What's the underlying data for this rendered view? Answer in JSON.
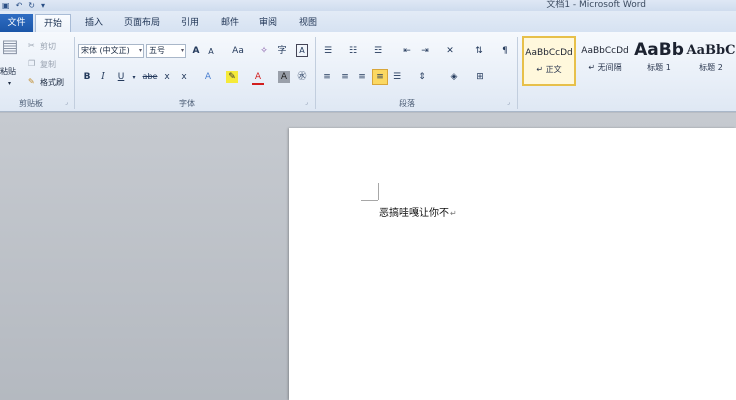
{
  "window": {
    "title": "文档1 - Microsoft Word"
  },
  "qat": {
    "save_icon": "save-icon",
    "undo_icon": "undo-icon",
    "redo_icon": "redo-icon",
    "customize_icon": "dropdown-icon"
  },
  "tabs": {
    "file": "文件",
    "home": "开始",
    "insert": "插入",
    "layout": "页面布局",
    "references": "引用",
    "mailings": "邮件",
    "review": "审阅",
    "view": "视图"
  },
  "clipboard": {
    "paste": "粘贴",
    "cut": "剪切",
    "copy": "复制",
    "format_painter": "格式刷",
    "label": "剪贴板"
  },
  "font": {
    "family": "宋体 (中文正)",
    "size": "五号",
    "grow": "A",
    "shrink": "A",
    "change_case": "Aa",
    "label": "字体",
    "bold": "B",
    "italic": "I",
    "underline": "U",
    "strike": "abe",
    "subscript": "x",
    "superscript": "x"
  },
  "paragraph": {
    "label": "段落"
  },
  "styles": {
    "items": [
      {
        "sample": "AaBbCcDd",
        "name": "正文",
        "prefix": "↵"
      },
      {
        "sample": "AaBbCcDd",
        "name": "无间隔",
        "prefix": "↵"
      },
      {
        "sample": "AaBb",
        "name": "标题 1",
        "prefix": ""
      },
      {
        "sample": "AaBbC",
        "name": "标题 2",
        "prefix": ""
      }
    ]
  },
  "document": {
    "text": "恶搞哇嘎让你不",
    "pilcrow": "↵"
  },
  "colors": {
    "file_tab": "#1b56a8",
    "selected_style_border": "#e7c04a",
    "page": "#ffffff",
    "workspace": "#b8bcc3"
  }
}
